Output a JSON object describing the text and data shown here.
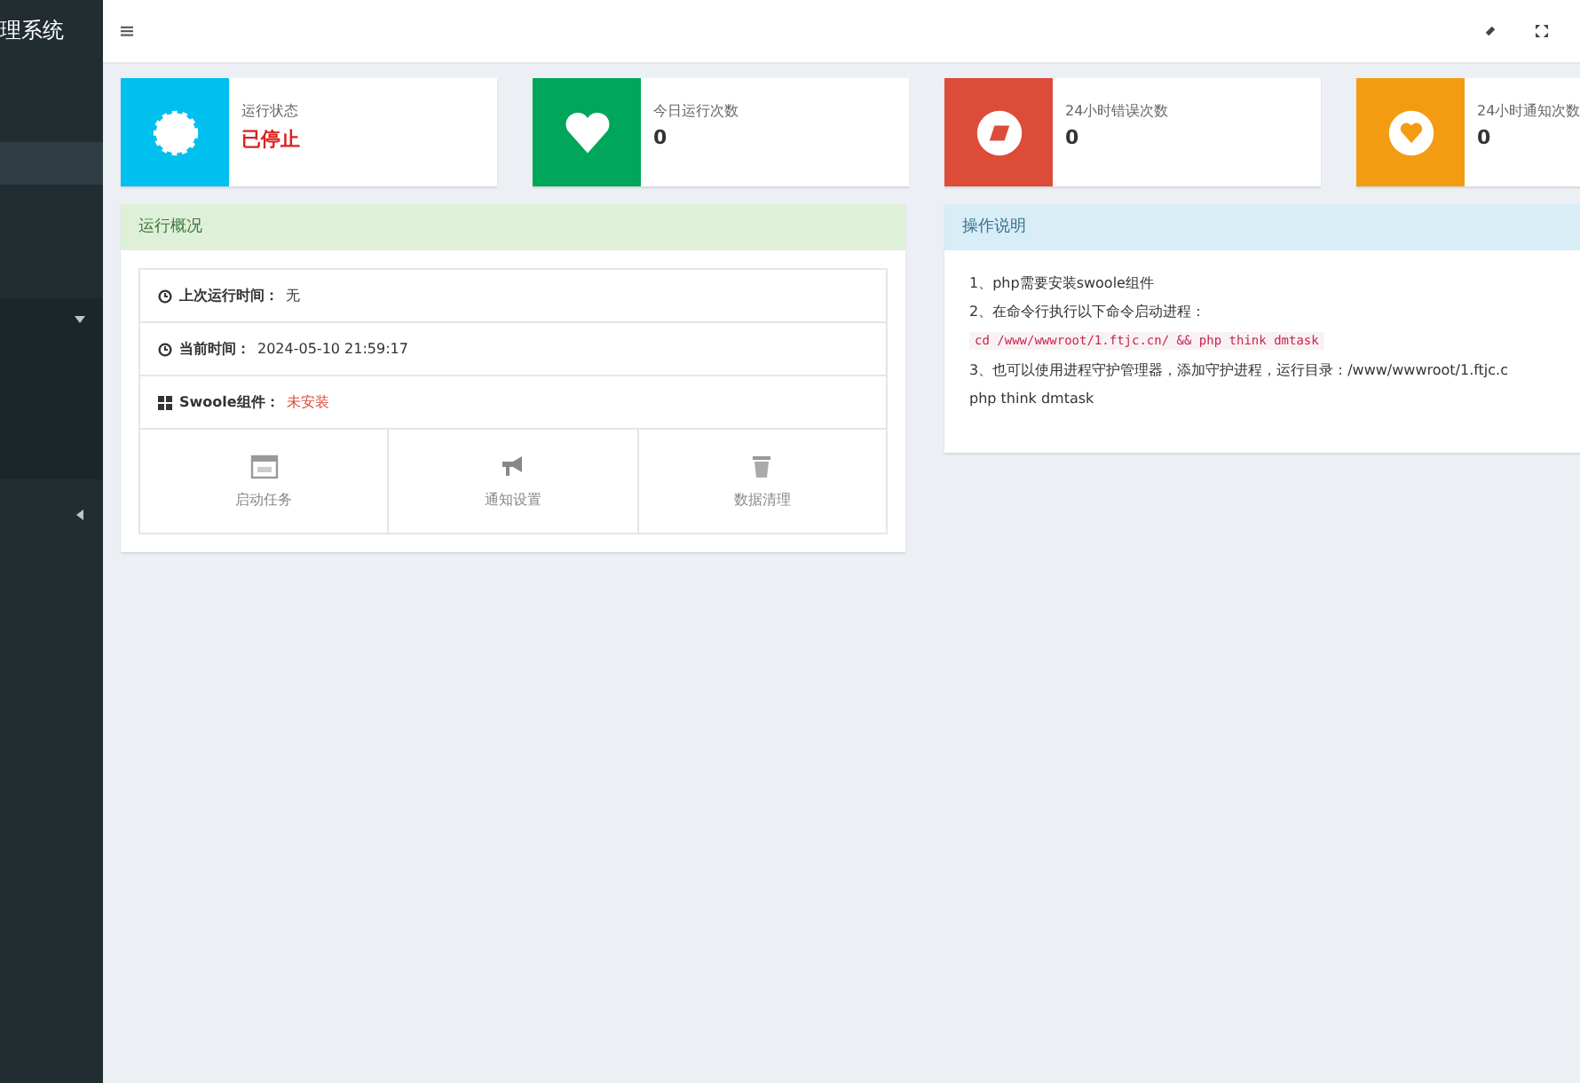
{
  "sidebar": {
    "title": "理系统",
    "items": [
      {
        "kind": "plain",
        "selected": true
      },
      {
        "kind": "group",
        "selected": false,
        "expanded": true
      },
      {
        "kind": "group",
        "selected": false,
        "expanded": false
      }
    ]
  },
  "stats": [
    {
      "label": "运行状态",
      "value": "已停止",
      "color": "#00c0ef",
      "alert": true
    },
    {
      "label": "今日运行次数",
      "value": "0",
      "color": "#00a65a",
      "alert": false
    },
    {
      "label": "24小时错误次数",
      "value": "0",
      "color": "#dd4b39",
      "alert": false
    },
    {
      "label": "24小时通知次数",
      "value": "0",
      "color": "#f39c12",
      "alert": false
    }
  ],
  "overview": {
    "title": "运行概况",
    "rows": [
      {
        "label": "上次运行时间：",
        "value": "无",
        "alert": false
      },
      {
        "label": "当前时间：",
        "value": "2024-05-10 21:59:17",
        "alert": false
      },
      {
        "label": "Swoole组件：",
        "value": "未安装",
        "alert": true
      }
    ],
    "actions": [
      {
        "label": "启动任务"
      },
      {
        "label": "通知设置"
      },
      {
        "label": "数据清理"
      }
    ]
  },
  "help": {
    "title": "操作说明",
    "lines": [
      {
        "kind": "text",
        "text": "1、php需要安装swoole组件"
      },
      {
        "kind": "text",
        "text": "2、在命令行执行以下命令启动进程："
      },
      {
        "kind": "code",
        "text": "cd /www/wwwroot/1.ftjc.cn/ && php think dmtask"
      },
      {
        "kind": "text",
        "text": "3、也可以使用进程守护管理器，添加守护进程，运行目录：/www/wwwroot/1.ftjc.c"
      },
      {
        "kind": "text",
        "text": "php think dmtask"
      }
    ]
  }
}
